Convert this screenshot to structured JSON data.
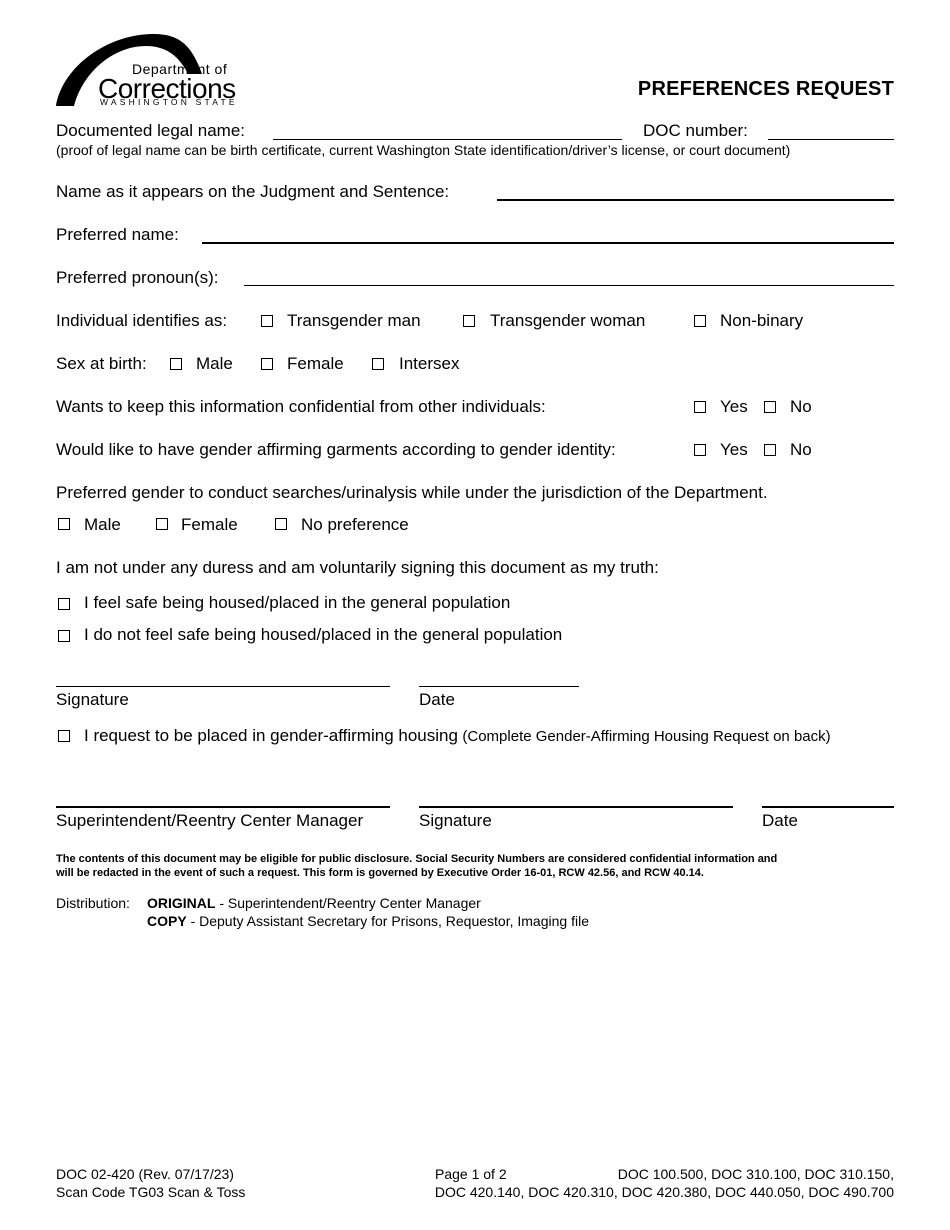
{
  "header": {
    "logo": {
      "line1": "Department of",
      "line2": "Corrections",
      "line3": "WASHINGTON STATE"
    },
    "title": "PREFERENCES REQUEST"
  },
  "fields": {
    "legal_name": {
      "label": "Documented legal name:",
      "value": ""
    },
    "doc_number": {
      "label": "DOC number:",
      "value": ""
    },
    "legal_name_note": "(proof of legal name can be birth certificate, current Washington State identification/driver’s license, or court document)",
    "judgment_name": {
      "label": "Name as it appears on the Judgment and Sentence:",
      "value": ""
    },
    "preferred_name": {
      "label": "Preferred name:",
      "value": ""
    },
    "preferred_pronouns": {
      "label": "Preferred pronoun(s):",
      "value": ""
    }
  },
  "identifies_as": {
    "label": "Individual identifies as:",
    "options": [
      {
        "label": "Transgender man",
        "checked": false
      },
      {
        "label": "Transgender woman",
        "checked": false
      },
      {
        "label": "Non-binary",
        "checked": false
      }
    ]
  },
  "sex_at_birth": {
    "label": "Sex at birth:",
    "options": [
      {
        "label": "Male",
        "checked": false
      },
      {
        "label": "Female",
        "checked": false
      },
      {
        "label": "Intersex",
        "checked": false
      }
    ]
  },
  "confidential": {
    "label": "Wants to keep this information confidential from other individuals:",
    "options": [
      {
        "label": "Yes",
        "checked": false
      },
      {
        "label": "No",
        "checked": false
      }
    ]
  },
  "garments": {
    "label": "Would like to have gender affirming garments according to gender identity:",
    "options": [
      {
        "label": "Yes",
        "checked": false
      },
      {
        "label": "No",
        "checked": false
      }
    ]
  },
  "searches": {
    "label": "Preferred gender to conduct searches/urinalysis while under the jurisdiction of the Department.",
    "options": [
      {
        "label": "Male",
        "checked": false
      },
      {
        "label": "Female",
        "checked": false
      },
      {
        "label": "No preference",
        "checked": false
      }
    ]
  },
  "declaration": {
    "label": "I am not under any duress and am voluntarily signing this document as my truth:",
    "options": [
      {
        "label": "I feel safe being housed/placed in the general population",
        "checked": false
      },
      {
        "label": "I do not feel safe being housed/placed in the general population",
        "checked": false
      }
    ]
  },
  "signature_block_1": {
    "signature_label": "Signature",
    "date_label": "Date"
  },
  "housing_request": {
    "label": "I request to be placed in gender-affirming housing",
    "note": "(Complete Gender-Affirming Housing Request on back)",
    "checked": false
  },
  "signature_block_2": {
    "manager_label": "Superintendent/Reentry Center Manager",
    "signature_label": "Signature",
    "date_label": "Date"
  },
  "disclosure": {
    "line1": "The contents of this document may be eligible for public disclosure.  Social Security Numbers are considered confidential information and",
    "line2": "will be redacted in the event of such a request.  This form is governed by Executive Order 16-01, RCW 42.56, and RCW 40.14."
  },
  "distribution": {
    "label": "Distribution:",
    "original_key": "ORIGINAL",
    "original_text": " - Superintendent/Reentry Center Manager",
    "copy_key": "COPY",
    "copy_text": " - Deputy Assistant Secretary for Prisons, Requestor, Imaging file"
  },
  "footer": {
    "form_number": "DOC 02-420 (Rev. 07/17/23)",
    "scan_code": "Scan Code TG03 Scan & Toss",
    "page": "Page 1 of 2",
    "policies_line1": "DOC 100.500, DOC 310.100, DOC 310.150,",
    "policies_line2": "DOC 420.140, DOC 420.310, DOC 420.380, DOC 440.050, DOC 490.700"
  }
}
